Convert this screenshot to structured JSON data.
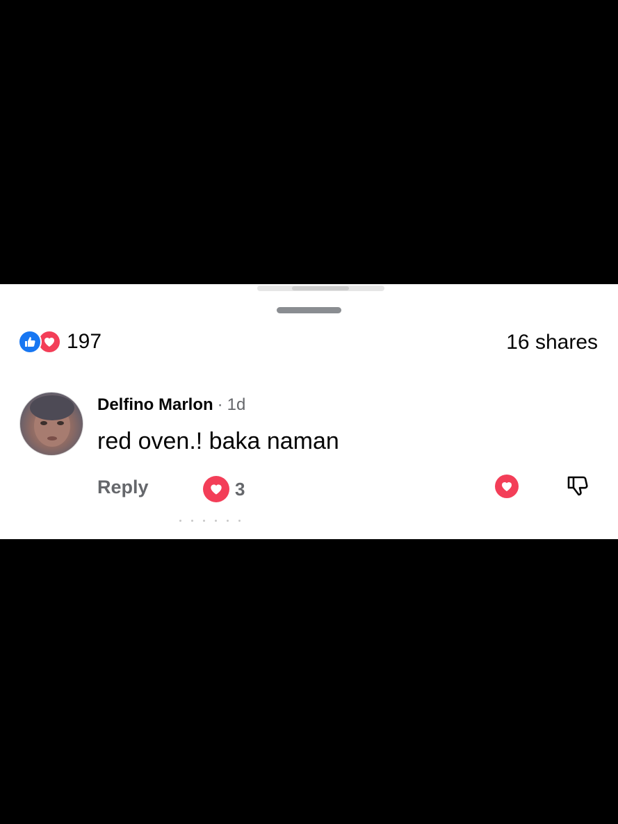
{
  "reactions": {
    "icons": [
      "like-icon",
      "love-icon"
    ],
    "count": "197",
    "like_color": "#1877f2",
    "love_color": "#f33e58"
  },
  "shares": "16 shares",
  "comment": {
    "author": "Delfino Marlon",
    "separator": "·",
    "time": "1d",
    "text": "red oven.! baka naman",
    "reply_label": "Reply",
    "love_count": "3"
  },
  "actions": {
    "love_icon": "heart-icon",
    "dislike_icon": "thumbs-down-icon"
  }
}
